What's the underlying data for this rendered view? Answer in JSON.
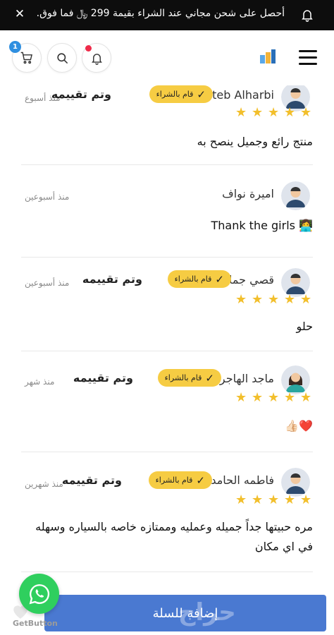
{
  "announcement": {
    "text": "أحصل على شحن مجاني عند الشراء بقيمة 299 ﷼ فما فوق.",
    "close_icon": "close-icon",
    "bell_icon": "bell-icon"
  },
  "header": {
    "cart_count": "1",
    "icons": [
      "cart-icon",
      "search-icon",
      "bell-icon",
      "store-logo",
      "menu-icon"
    ]
  },
  "colors": {
    "accent": "#4a79d1",
    "badge": "#f6cc43",
    "star": "#f2bf2c",
    "notification_dot": "#ef2b4a",
    "whatsapp": "#2fcf5e"
  },
  "reviews": [
    {
      "name": "Moteb Alharbi",
      "date": "منذ أسبوع",
      "verified_label": "قام بالشراء",
      "rated_label": "وتم تقييمه",
      "rating": 5,
      "text": "منتج رائع وجميل ينصح به"
    },
    {
      "name": "اميرة نواف",
      "date": "منذ أسبوعين",
      "rating": 0,
      "text": "👩‍💻 Thank the girls"
    },
    {
      "name": "قصي جمال",
      "date": "منذ أسبوعين",
      "verified_label": "قام بالشراء",
      "rated_label": "وتم تقييمه",
      "rating": 5,
      "text": "حلو"
    },
    {
      "name": "ماجد الهاجري",
      "date": "منذ شهر",
      "verified_label": "قام بالشراء",
      "rated_label": "وتم تقييمه",
      "rating": 5,
      "text": "❤️👍🏻"
    },
    {
      "name": "فاطمه الحامدي",
      "date": "منذ شهرين",
      "verified_label": "قام بالشراء",
      "rated_label": "وتم تقييمه",
      "rating": 5,
      "text": "مره حبيتها جداً جميله وعمليه وممتازه خاصه بالسياره وسهله في اي مكان"
    }
  ],
  "bottom": {
    "add_to_cart_label": "إضافة للسلة",
    "watermark": "حراج",
    "getbutton_label": "GetButton",
    "whatsapp_icon": "whatsapp-icon"
  }
}
